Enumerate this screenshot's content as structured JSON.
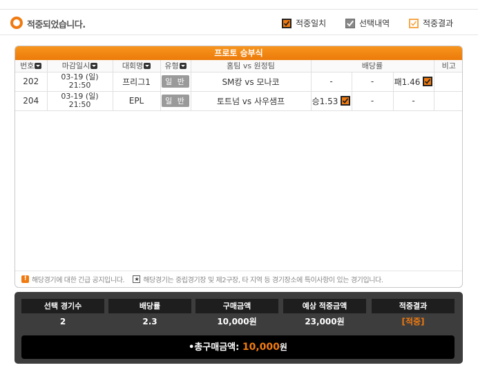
{
  "status": {
    "text": "적중되었습니다."
  },
  "legend": [
    {
      "label": "적중일치"
    },
    {
      "label": "선택내역"
    },
    {
      "label": "적중결과"
    }
  ],
  "panel": {
    "title": "프로토 승부식",
    "columns": [
      "번호",
      "마감일시",
      "대회명",
      "유형",
      "홈팀 vs 원정팀",
      "배당률",
      "비고"
    ],
    "rows": [
      {
        "no": "202",
        "date": "03-19 (일)",
        "time": "21:50",
        "league": "프리그1",
        "type": "일 반",
        "match": "SM캉 vs 모나코",
        "odds_win": "-",
        "odds_draw": "-",
        "odds_lose": "패1.46",
        "note": ""
      },
      {
        "no": "204",
        "date": "03-19 (일)",
        "time": "21:50",
        "league": "EPL",
        "type": "일 반",
        "match": "토트넘 vs 사우샘프",
        "odds_win": "승1.53",
        "odds_draw": "-",
        "odds_lose": "-",
        "note": ""
      }
    ]
  },
  "notice": {
    "excl": "!",
    "text1": "해당경기에 대한 긴급 공지입니다.",
    "star": "★",
    "text2": "해당경기는 중립경기장 및 제2구장, 타 지역 등 경기장소에 특이사항이 있는 경기입니다."
  },
  "summary": {
    "labels": [
      "선택 경기수",
      "배당률",
      "구매금액",
      "예상 적중금액",
      "적중결과"
    ],
    "values": [
      "2",
      "2.3",
      "10,000원",
      "23,000원",
      "[적중]"
    ],
    "total_label": "•총구매금액: ",
    "total_amount": "10,000",
    "total_unit": "원"
  },
  "colors": {
    "accent": "#f07a10",
    "dark": "#3d3d3d"
  }
}
